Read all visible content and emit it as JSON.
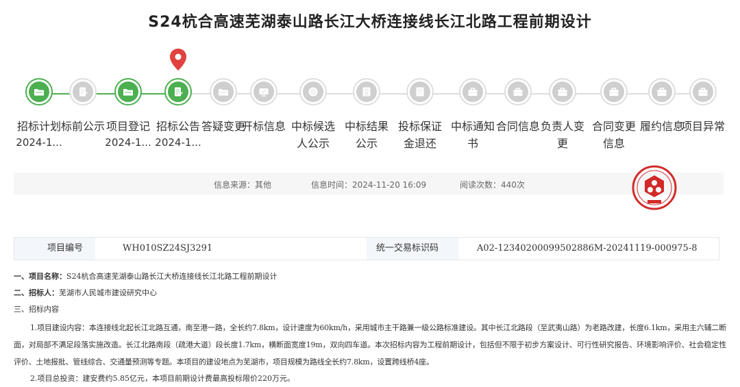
{
  "page": {
    "title": "S24杭合高速芜湖泰山路长江大桥连接线长江北路工程前期设计"
  },
  "steps": [
    {
      "label": "招标计划",
      "date": "2024-1...",
      "done": true,
      "icon": "folder-icon"
    },
    {
      "label": "标前公示",
      "date": "",
      "done": false,
      "icon": "edit-doc-icon"
    },
    {
      "label": "项目登记",
      "date": "2024-1...",
      "done": true,
      "icon": "folder-icon"
    },
    {
      "label": "招标公告",
      "date": "2024-1...",
      "done": true,
      "icon": "edit-doc-icon"
    },
    {
      "label": "答疑变更",
      "date": "",
      "done": false,
      "icon": "folder-icon"
    },
    {
      "label": "开标信息",
      "date": "",
      "done": false,
      "icon": "tv-icon"
    },
    {
      "label": "中标候选人公示",
      "date": "",
      "done": false,
      "icon": "target-icon"
    },
    {
      "label": "中标结果公示",
      "date": "",
      "done": false,
      "icon": "award-doc-icon"
    },
    {
      "label": "投标保证金退还",
      "date": "",
      "done": false,
      "icon": "doc-list-icon"
    },
    {
      "label": "中标通知书",
      "date": "",
      "done": false,
      "icon": "briefcase-icon"
    },
    {
      "label": "合同信息",
      "date": "",
      "done": false,
      "icon": "briefcase-icon"
    },
    {
      "label": "负责人变更",
      "date": "",
      "done": false,
      "icon": "briefcase-icon"
    },
    {
      "label": "合同变更信息",
      "date": "",
      "done": false,
      "icon": "briefcase-icon"
    },
    {
      "label": "履约信息",
      "date": "",
      "done": false,
      "icon": "briefcase-icon"
    },
    {
      "label": "项目异常",
      "date": "",
      "done": false,
      "icon": "briefcase-icon"
    }
  ],
  "info": {
    "source": "信息来源：其他",
    "time": "信息时间：2024-11-20 16:09",
    "views": "阅读次数：440次"
  },
  "table": {
    "project_no_label": "项目编号",
    "project_no": "WH010SZ24SJ3291",
    "trade_code_label": "统一交易标识码",
    "trade_code": "A02-12340200099502886M-20241119-000975-8"
  },
  "content": {
    "item1_label": "一、项目名称：",
    "item1_value": "S24杭合高速芜湖泰山路长江大桥连接线长江北路工程前期设计",
    "item2_label": "二、招标人：",
    "item2_value": "芜湖市人民城市建设研究中心",
    "item3": "三、招标内容",
    "para1": "1.项目建设内容：本连接线北起长江北路互通，南至港一路，全长约7.8km，设计速度为60km/h，采用城市主干路兼一级公路标准建设。其中长江北路段（至武夷山路）为老路改建，长度6.1km，采用主六辅二断面，对局部不满足段落实施改造。长江北路南段（疏港大道）段长度1.7km，横断面宽度19m，双向四车道。本次招标内容为工程前期设计，包括但不限于初步方案设计、可行性研究报告、环境影响评价、社会稳定性评价、土地报批、管线综合、交通量预测等专题。本项目的建设地点为芜湖市，项目规模为路线全长约7.8km，设置跨线桥4座。",
    "para2": "2.项目总投资：建安费约5.85亿元，本项目前期设计费最高投标限价220万元。"
  },
  "colors": {
    "done": "#4caf50",
    "pending": "#cfcfcf",
    "pin": "#e0423f",
    "seal": "#d22a2a"
  }
}
